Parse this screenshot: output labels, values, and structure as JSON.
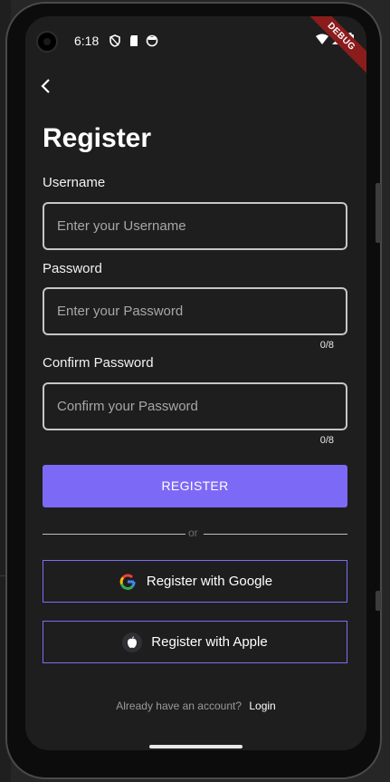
{
  "status_bar": {
    "time": "6:18",
    "debug_banner": "DEBUG"
  },
  "page": {
    "title": "Register"
  },
  "form": {
    "username": {
      "label": "Username",
      "placeholder": "Enter your Username"
    },
    "password": {
      "label": "Password",
      "placeholder": "Enter your Password",
      "counter": "0/8"
    },
    "confirm_password": {
      "label": "Confirm Password",
      "placeholder": "Confirm your Password",
      "counter": "0/8"
    }
  },
  "actions": {
    "register_label": "REGISTER",
    "divider_text": "or",
    "google_label": "Register with Google",
    "apple_label": "Register with Apple"
  },
  "footer": {
    "question": "Already have an account?",
    "login_link": "Login"
  },
  "colors": {
    "accent": "#7c6af6",
    "outline": "#7b6ff2",
    "background": "#1e1e1f",
    "debug": "#8b1c1c"
  },
  "icons": [
    "back-arrow-icon",
    "vpn-key-icon",
    "sd-card-icon",
    "face-icon",
    "wifi-icon",
    "signal-icon",
    "battery-icon",
    "google-icon",
    "apple-icon"
  ]
}
